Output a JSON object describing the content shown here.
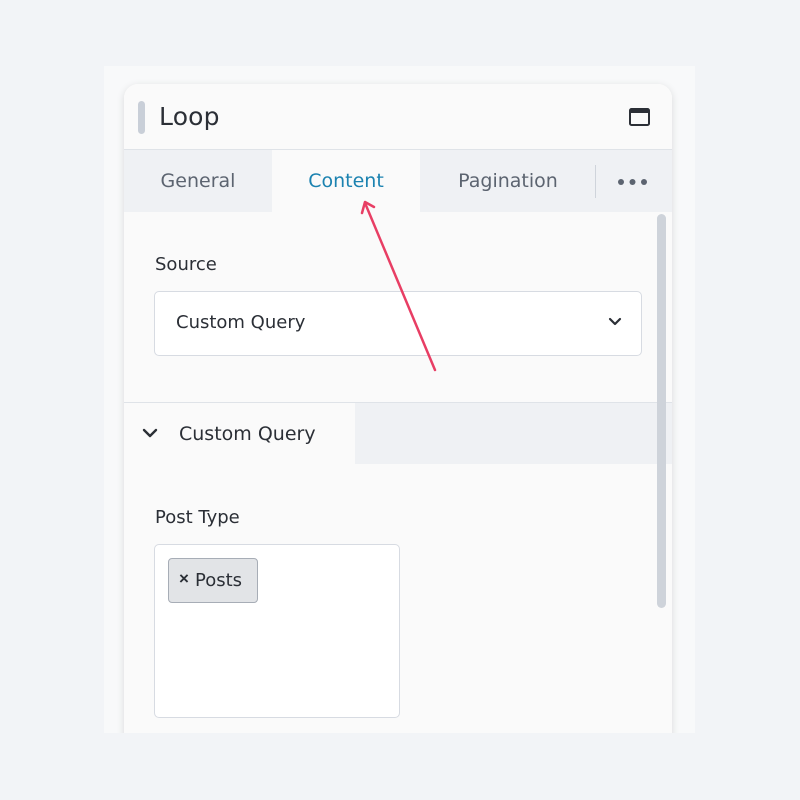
{
  "panel": {
    "title": "Loop"
  },
  "tabs": [
    {
      "label": "General",
      "active": false
    },
    {
      "label": "Content",
      "active": true
    },
    {
      "label": "Pagination",
      "active": false
    }
  ],
  "content": {
    "source_label": "Source",
    "source_value": "Custom Query",
    "section_title": "Custom Query",
    "post_type_label": "Post Type",
    "post_type_tokens": [
      {
        "remove": "×",
        "label": "Posts"
      }
    ]
  },
  "icons": {
    "window": "window-maximize-icon",
    "more": "more-horizontal-icon",
    "select_arrow": "chevron-down-icon",
    "section_toggle": "chevron-down-icon",
    "annotation": "arrow-icon"
  },
  "colors": {
    "accent": "#1b82b0",
    "annotation_arrow": "#e83e64",
    "background": "#f2f4f7",
    "panel": "#fafafa"
  }
}
